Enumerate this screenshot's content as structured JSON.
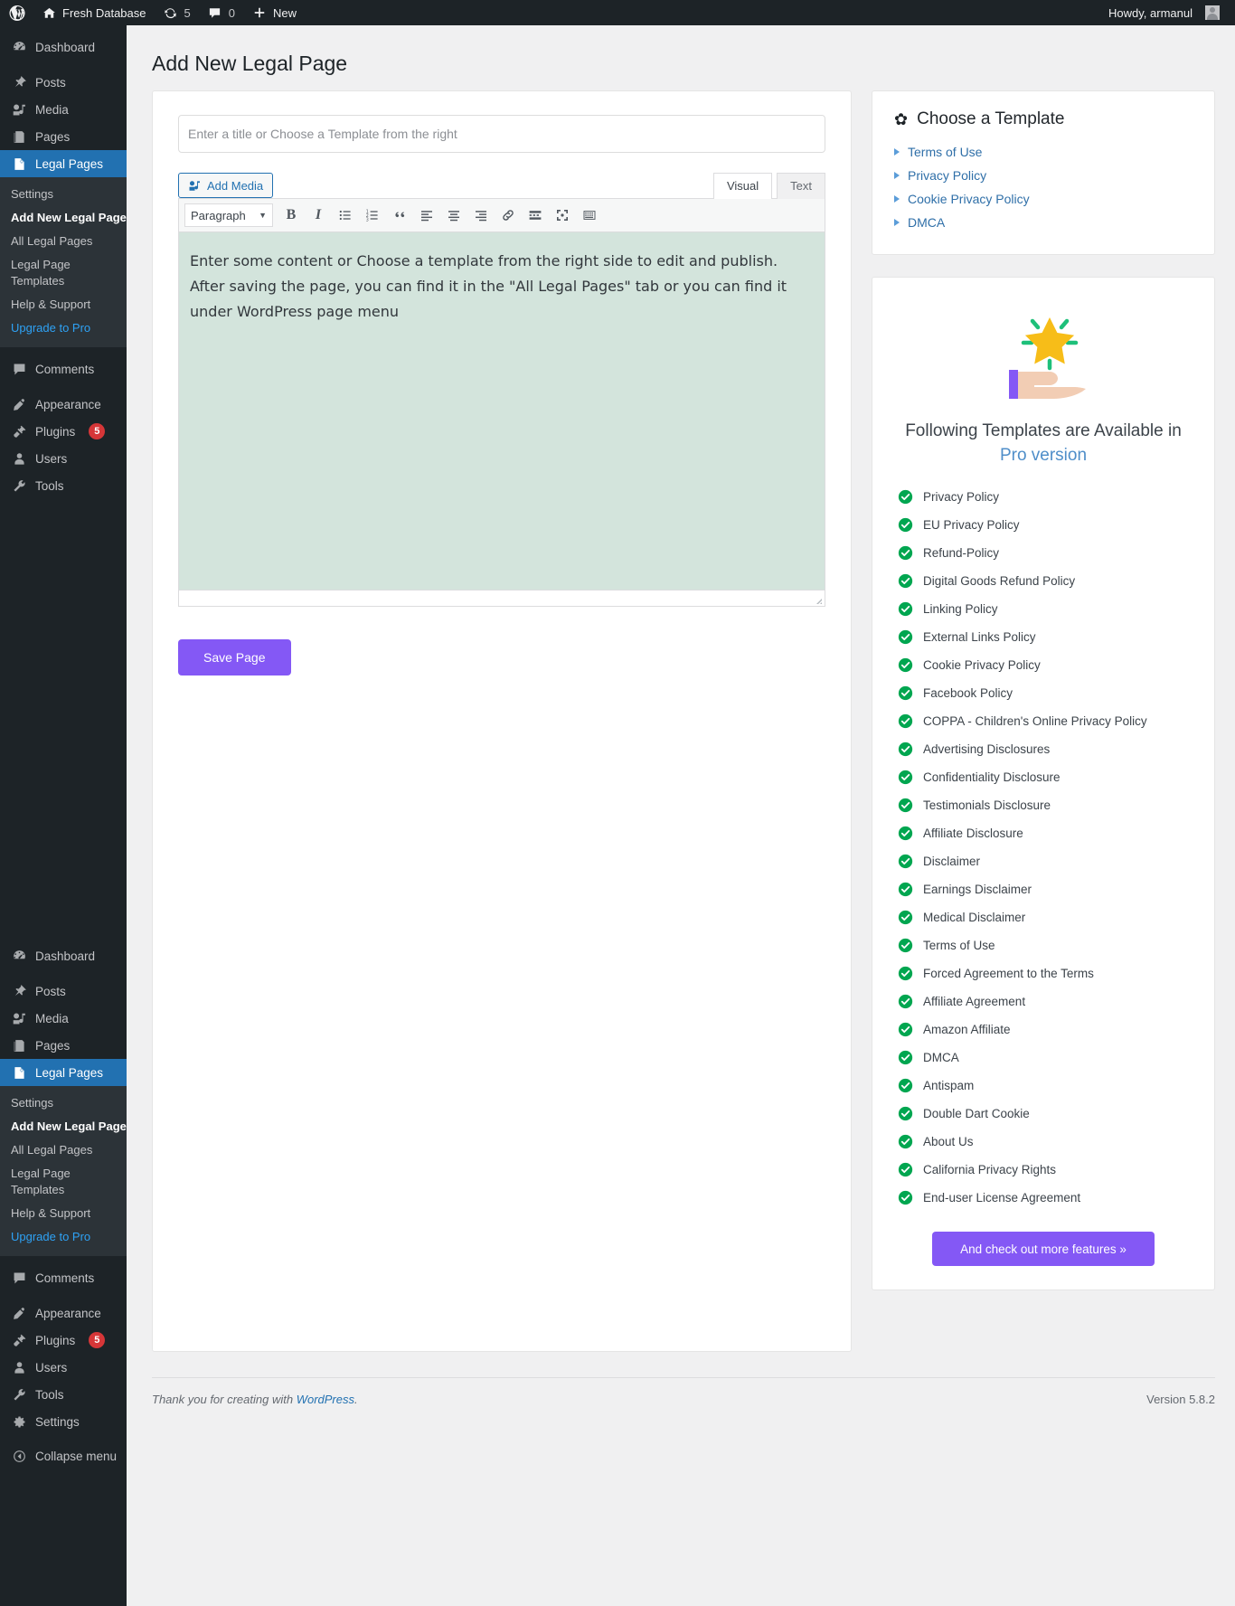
{
  "adminbar": {
    "site_name": "Fresh Database",
    "updates_count": "5",
    "comments_count": "0",
    "new_label": "New",
    "howdy": "Howdy, armanul"
  },
  "sidebar": {
    "items": [
      {
        "label": "Dashboard",
        "icon": "dashboard-icon"
      },
      {
        "label": "Posts",
        "icon": "posts-icon"
      },
      {
        "label": "Media",
        "icon": "media-icon"
      },
      {
        "label": "Pages",
        "icon": "pages-icon"
      },
      {
        "label": "Legal Pages",
        "icon": "legal-pages-icon"
      },
      {
        "label": "Comments",
        "icon": "comments-icon"
      },
      {
        "label": "Appearance",
        "icon": "appearance-icon"
      },
      {
        "label": "Plugins",
        "icon": "plugins-icon",
        "badge": "5"
      },
      {
        "label": "Users",
        "icon": "users-icon"
      },
      {
        "label": "Tools",
        "icon": "tools-icon"
      },
      {
        "label": "Settings",
        "icon": "settings-icon"
      }
    ],
    "legal_submenu": [
      {
        "label": "Settings"
      },
      {
        "label": "Add New Legal Page"
      },
      {
        "label": "All Legal Pages"
      },
      {
        "label": "Legal Page Templates"
      },
      {
        "label": "Help & Support"
      },
      {
        "label": "Upgrade to Pro"
      }
    ],
    "collapse_label": "Collapse menu"
  },
  "page": {
    "title": "Add New Legal Page"
  },
  "editor": {
    "title_placeholder": "Enter a title or Choose a Template from the right",
    "title_value": "",
    "add_media_label": "Add Media",
    "tab_visual": "Visual",
    "tab_text": "Text",
    "format_select": "Paragraph",
    "content": "Enter some content or Choose a template from the right side to edit and publish. After saving the page, you can find it in the \"All Legal Pages\" tab or you can find it under WordPress page menu",
    "save_label": "Save Page",
    "toolbar_buttons": [
      "bold-icon",
      "italic-icon",
      "bulleted-list-icon",
      "numbered-list-icon",
      "blockquote-icon",
      "align-left-icon",
      "align-center-icon",
      "align-right-icon",
      "link-icon",
      "read-more-icon",
      "fullscreen-icon",
      "toolbar-toggle-icon"
    ]
  },
  "choose_template": {
    "heading": "Choose a Template",
    "items": [
      {
        "label": "Terms of Use"
      },
      {
        "label": "Privacy Policy"
      },
      {
        "label": "Cookie Privacy Policy"
      },
      {
        "label": "DMCA"
      }
    ]
  },
  "pro_panel": {
    "title": "Following Templates are Available in",
    "title_highlight": "Pro version",
    "cta_label": "And check out more features »",
    "features": [
      "Privacy Policy",
      "EU Privacy Policy",
      "Refund-Policy",
      "Digital Goods Refund Policy",
      "Linking Policy",
      "External Links Policy",
      "Cookie Privacy Policy",
      "Facebook Policy",
      "COPPA - Children's Online Privacy Policy",
      "Advertising Disclosures",
      "Confidentiality Disclosure",
      "Testimonials Disclosure",
      "Affiliate Disclosure",
      "Disclaimer",
      "Earnings Disclaimer",
      "Medical Disclaimer",
      "Terms of Use",
      "Forced Agreement to the Terms",
      "Affiliate Agreement",
      "Amazon Affiliate",
      "DMCA",
      "Antispam",
      "Double Dart Cookie",
      "About Us",
      "California Privacy Rights",
      "End-user License Agreement"
    ]
  },
  "footer": {
    "thanks_prefix": "Thank you for creating with ",
    "thanks_link": "WordPress",
    "thanks_suffix": ".",
    "version": "Version 5.8.2"
  },
  "colors": {
    "accent_blue": "#2271b1",
    "purple": "#8458f5",
    "green_check": "#00a650",
    "editor_bg": "#d3e4dc"
  }
}
